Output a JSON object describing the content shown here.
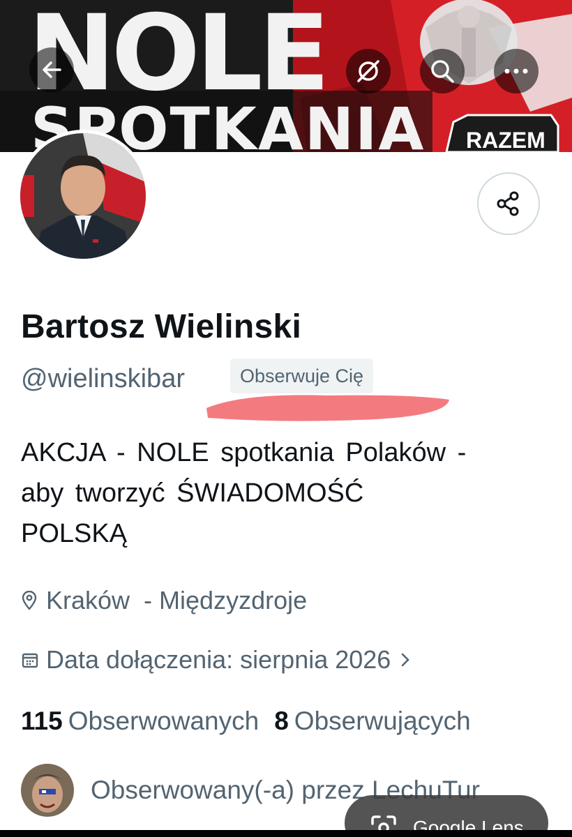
{
  "banner": {
    "headline_top": "NOLE",
    "headline_bottom": "SPOTKANIA",
    "badge": "RAZEM"
  },
  "header": {
    "back_icon": "arrow-left-icon",
    "grok_icon": "grok-icon",
    "search_icon": "search-icon",
    "more_icon": "more-icon"
  },
  "profile": {
    "display_name": "Bartosz Wielinski",
    "handle": "@wielinskibar",
    "follows_you_label": "Obserwuje Cię",
    "bio_lines": [
      "AKCJA - NOLE spotkania Polaków -",
      "aby tworzyć ŚWIADOMOŚĆ",
      "POLSKĄ"
    ],
    "location": "Kraków  - Międzyzdroje",
    "joined": "Data dołączenia: sierpnia 2026",
    "following_count": "115",
    "following_label": "Obserwowanych",
    "followers_count": "8",
    "followers_label": "Obserwujących",
    "followed_by": "Obserwowany(-a) przez LechuTur"
  },
  "overlay": {
    "lens_label": "Google Lens"
  },
  "colors": {
    "text": "#0f1419",
    "secondary": "#536471",
    "redaction": "#f26d72",
    "banner_red": "#d51f26"
  }
}
